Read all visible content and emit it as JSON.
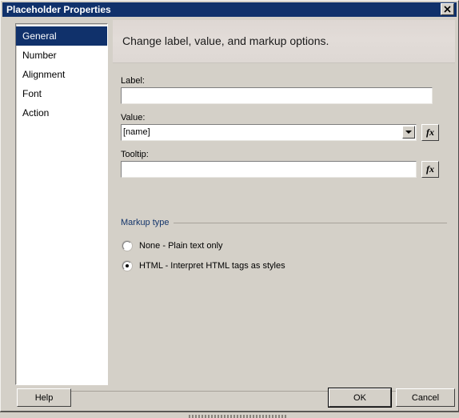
{
  "window": {
    "title": "Placeholder Properties",
    "close_icon": "close-icon",
    "close_glyph": "✕"
  },
  "sidebar": {
    "items": [
      {
        "label": "General",
        "selected": true
      },
      {
        "label": "Number",
        "selected": false
      },
      {
        "label": "Alignment",
        "selected": false
      },
      {
        "label": "Font",
        "selected": false
      },
      {
        "label": "Action",
        "selected": false
      }
    ]
  },
  "content": {
    "header_title": "Change label, value, and markup options.",
    "fields": {
      "label": {
        "caption": "Label:",
        "value": "",
        "placeholder": ""
      },
      "value": {
        "caption": "Value:",
        "value": "[name]",
        "dropdown_icon": "chevron-down-icon",
        "fx_button_label": "fx"
      },
      "tooltip": {
        "caption": "Tooltip:",
        "value": "",
        "placeholder": "",
        "fx_button_label": "fx"
      }
    },
    "markup_group": {
      "title": "Markup type",
      "options": [
        {
          "label": "None - Plain text only",
          "selected": false
        },
        {
          "label": "HTML - Interpret HTML tags as styles",
          "selected": true
        }
      ]
    }
  },
  "footer": {
    "help_label": "Help",
    "ok_label": "OK",
    "cancel_label": "Cancel"
  },
  "colors": {
    "titlebar": "#10316b",
    "dialog_face": "#d4d0c8",
    "selection": "#10316b",
    "group_title": "#14356b",
    "field_text": "#000000"
  }
}
